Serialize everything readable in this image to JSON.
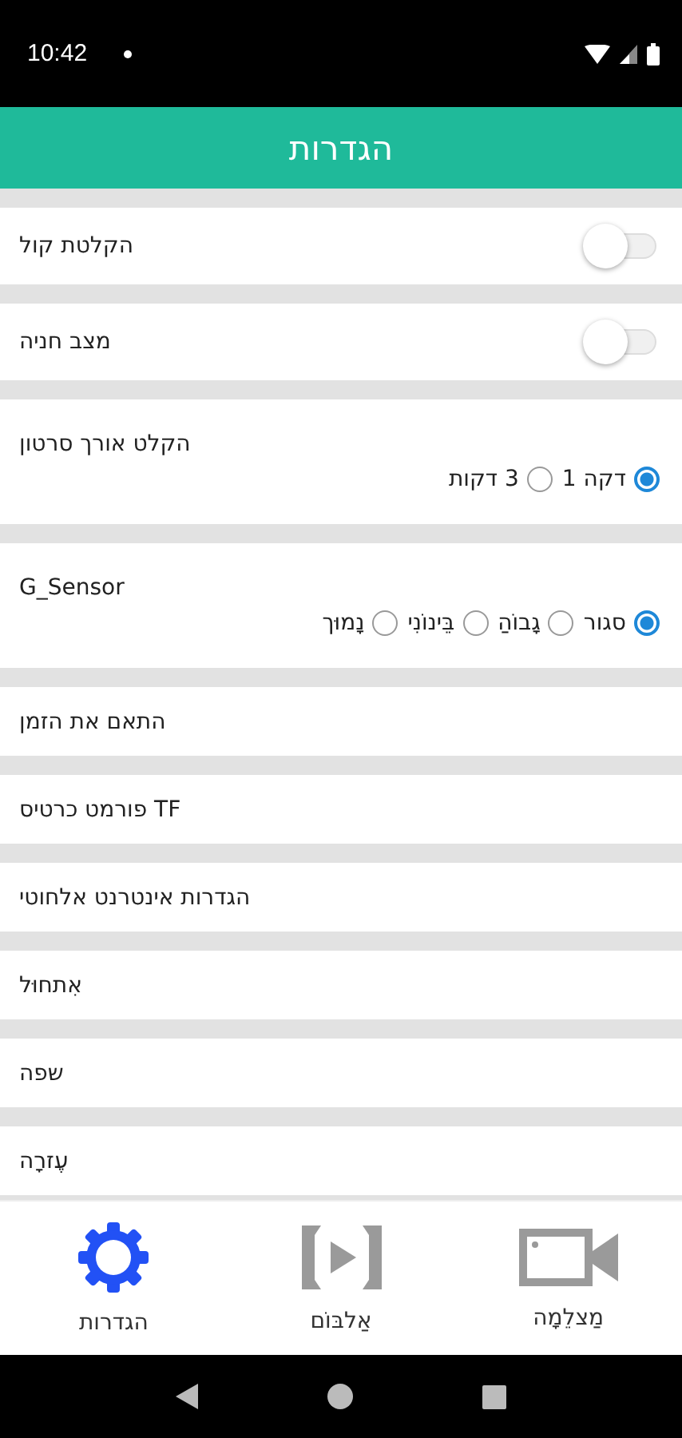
{
  "status_bar": {
    "time": "10:42"
  },
  "header": {
    "title": "הגדרות"
  },
  "settings": [
    {
      "kind": "toggle",
      "label": "הקלטת קול",
      "on": false
    },
    {
      "kind": "toggle",
      "label": "מצב חניה",
      "on": false
    },
    {
      "kind": "radio",
      "label": "הקלט אורך סרטון",
      "options": [
        {
          "label": "דקה 1",
          "selected": true
        },
        {
          "label": "3 דקות",
          "selected": false
        }
      ]
    },
    {
      "kind": "radio",
      "label": "G_Sensor",
      "options": [
        {
          "label": "סגור",
          "selected": true
        },
        {
          "label": "גָבוֹהַ",
          "selected": false
        },
        {
          "label": "בֵּינוֹנִי",
          "selected": false
        },
        {
          "label": "נָמוּך",
          "selected": false
        }
      ]
    },
    {
      "kind": "link",
      "label": "התאם את הזמן"
    },
    {
      "kind": "link",
      "label": "פורמט כרטיס TF"
    },
    {
      "kind": "link",
      "label": "הגדרות אינטרנט אלחוטי"
    },
    {
      "kind": "link",
      "label": "אִתחוּל"
    },
    {
      "kind": "link",
      "label": "שפה"
    },
    {
      "kind": "link",
      "label": "עֶזרָה"
    }
  ],
  "bottom_nav": [
    {
      "kind": "camera",
      "label": "מַצלֵמָה",
      "selected": false
    },
    {
      "kind": "album",
      "label": "אַלבּוֹם",
      "selected": false
    },
    {
      "kind": "settings",
      "label": "הגדרות",
      "selected": true
    }
  ]
}
